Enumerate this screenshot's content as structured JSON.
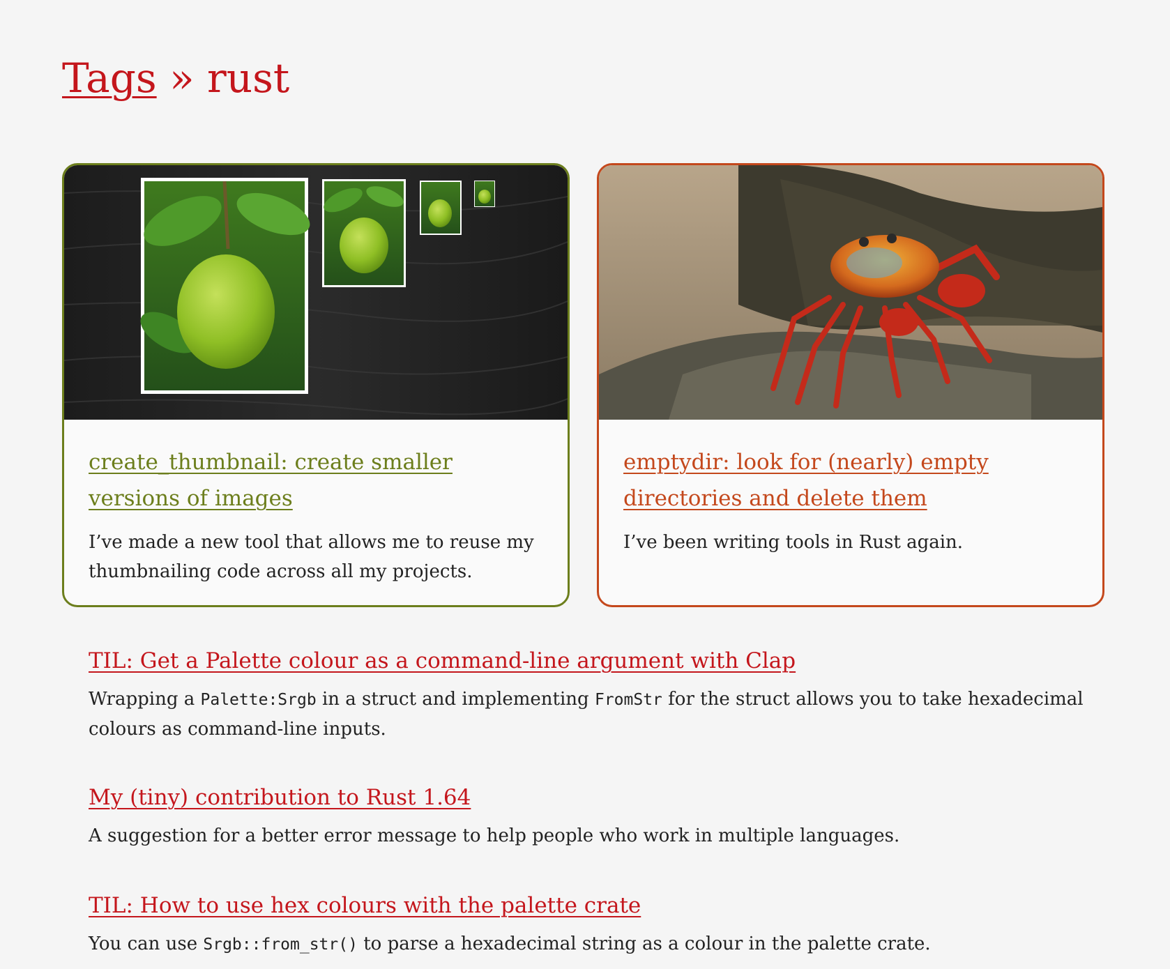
{
  "header": {
    "tags_link": "Tags",
    "separator": " » ",
    "tag_name": "rust"
  },
  "cards": [
    {
      "title": "create_thumbnail: create smaller versions of images",
      "description": "I’ve made a new tool that allows me to reuse my thumbnailing code across all my projects.",
      "image": "lime-thumbnails-image",
      "accent": "#6c7e1c"
    },
    {
      "title": "emptydir: look for (nearly) empty directories and delete them",
      "description": "I’ve been writing tools in Rust again.",
      "image": "red-crab-image",
      "accent": "#c4481c"
    }
  ],
  "posts": [
    {
      "title": "TIL: Get a Palette colour as a command-line argument with Clap",
      "desc_1": "Wrapping a ",
      "code_1": "Palette:Srgb",
      "desc_2": " in a struct and implementing ",
      "code_2": "FromStr",
      "desc_3": " for the struct allows you to take hexadecimal colours as command-line inputs."
    },
    {
      "title": "My (tiny) contribution to Rust 1.64",
      "desc_1": "A suggestion for a better error message to help people who work in multiple languages."
    },
    {
      "title": "TIL: How to use hex colours with the palette crate",
      "desc_1": "You can use ",
      "code_1": "Srgb::from_str()",
      "desc_2": " to parse a hexadecimal string as a colour in the palette crate."
    }
  ],
  "colors": {
    "link": "#c4161c",
    "green_accent": "#6c7e1c",
    "red_accent": "#c4481c",
    "background": "#f5f5f5"
  }
}
